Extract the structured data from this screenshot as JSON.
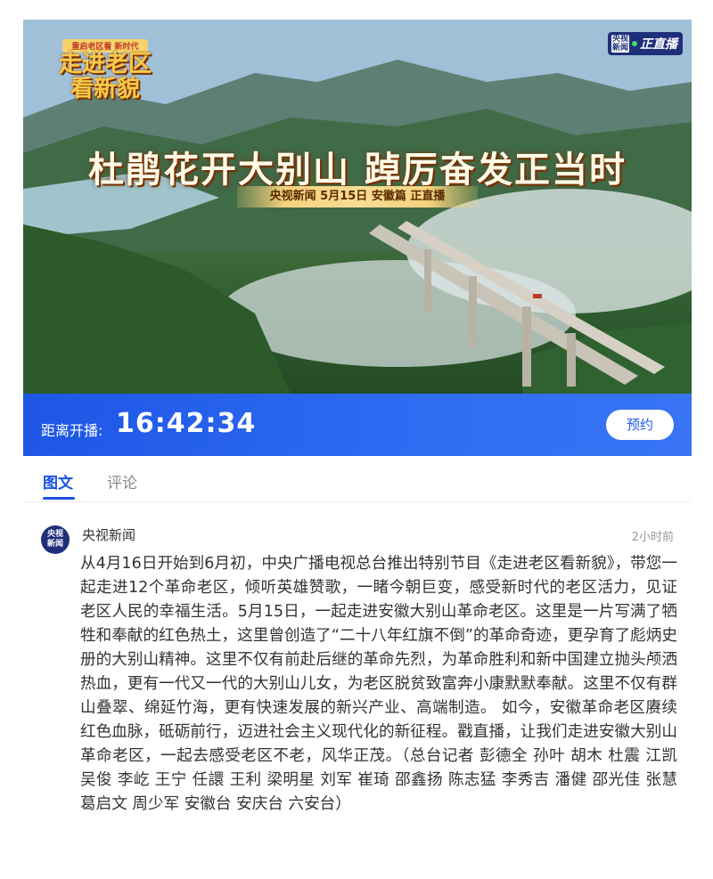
{
  "banner": {
    "logo_small": "重启老区看 新时代",
    "logo_line1": "走进老区",
    "logo_line2": "看新貌",
    "live_tag": {
      "cctv_line1": "央视",
      "cctv_line2": "新闻",
      "text": "正直播"
    },
    "title": "杜鹃花开大别山  踔厉奋发正当时",
    "subtitle": "央视新闻  5月15日  安徽篇  正直播"
  },
  "countdown": {
    "label": "距离开播:",
    "time": "16:42:34",
    "reserve_label": "预约"
  },
  "tabs": [
    {
      "label": "图文",
      "active": true
    },
    {
      "label": "评论",
      "active": false
    }
  ],
  "post": {
    "avatar_line1": "央视",
    "avatar_line2": "新闻",
    "author": "央视新闻",
    "time": "2小时前",
    "body": "从4月16日开始到6月初，中央广播电视总台推出特别节目《走进老区看新貌》，带您一起走进12个革命老区，倾听英雄赞歌，一睹今朝巨变，感受新时代的老区活力，见证老区人民的幸福生活。5月15日，一起走进安徽大别山革命老区。这里是一片写满了牺牲和奉献的红色热土，这里曾创造了“二十八年红旗不倒”的革命奇迹，更孕育了彪炳史册的大别山精神。这里不仅有前赴后继的革命先烈，为革命胜利和新中国建立抛头颅洒热血，更有一代又一代的大别山儿女，为老区脱贫致富奔小康默默奉献。这里不仅有群山叠翠、绵延竹海，更有快速发展的新兴产业、高端制造。 如今，安徽革命老区赓续红色血脉，砥砺前行，迈进社会主义现代化的新征程。戳直播，让我们走进安徽大别山革命老区，一起去感受老区不老，风华正茂。（总台记者 彭德全 孙叶 胡木 杜震 江凯 吴俊 李屹 王宁 任譞 王利 梁明星 刘军 崔琦 邵鑫扬 陈志猛 李秀吉 潘健 邵光佳 张慧 葛启文 周少军 安徽台 安庆台 六安台）"
  },
  "colors": {
    "accent": "#1a53e0",
    "countdown_bg": "#2e6cf2",
    "live_tag_bg": "#1f2f7a"
  }
}
